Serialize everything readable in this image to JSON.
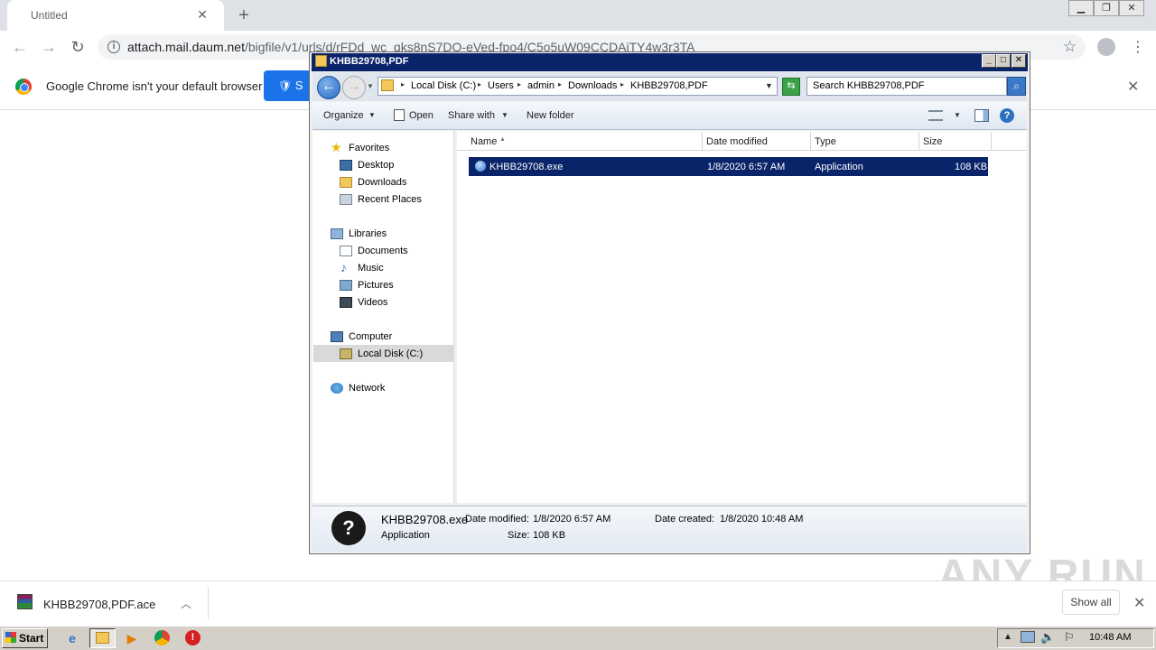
{
  "browser": {
    "tab_title": "Untitled",
    "url_host": "attach.mail.daum.net",
    "url_path": "/bigfile/v1/urls/d/rFDd_wc_qks8nS7DO-eVed-fpo4/C5o5uW09CCDAiTY4w3r3TA",
    "infobar_text": "Google Chrome isn't your default browser",
    "default_button_label": "S"
  },
  "explorer": {
    "title": "KHBB29708,PDF",
    "breadcrumbs": [
      "Local Disk (C:)",
      "Users",
      "admin",
      "Downloads",
      "KHBB29708,PDF"
    ],
    "search_placeholder": "Search KHBB29708,PDF",
    "commands": {
      "organize": "Organize",
      "open": "Open",
      "share_with": "Share with",
      "new_folder": "New folder"
    },
    "nav": {
      "favorites": "Favorites",
      "desktop": "Desktop",
      "downloads": "Downloads",
      "recent_places": "Recent Places",
      "libraries": "Libraries",
      "documents": "Documents",
      "music": "Music",
      "pictures": "Pictures",
      "videos": "Videos",
      "computer": "Computer",
      "local_disk": "Local Disk (C:)",
      "network": "Network"
    },
    "columns": {
      "name": "Name",
      "date_modified": "Date modified",
      "type": "Type",
      "size": "Size"
    },
    "files": [
      {
        "name": "KHBB29708.exe",
        "date_modified": "1/8/2020 6:57 AM",
        "type": "Application",
        "size": "108 KB"
      }
    ],
    "details": {
      "name": "KHBB29708.exe",
      "type": "Application",
      "date_modified_label": "Date modified:",
      "date_modified": "1/8/2020 6:57 AM",
      "date_created_label": "Date created:",
      "date_created": "1/8/2020 10:48 AM",
      "size_label": "Size:",
      "size": "108 KB"
    }
  },
  "downloads": {
    "file_name": "KHBB29708,PDF.ace",
    "show_all": "Show all"
  },
  "watermark": "ANY RUN",
  "taskbar": {
    "start": "Start",
    "clock": "10:48 AM"
  }
}
